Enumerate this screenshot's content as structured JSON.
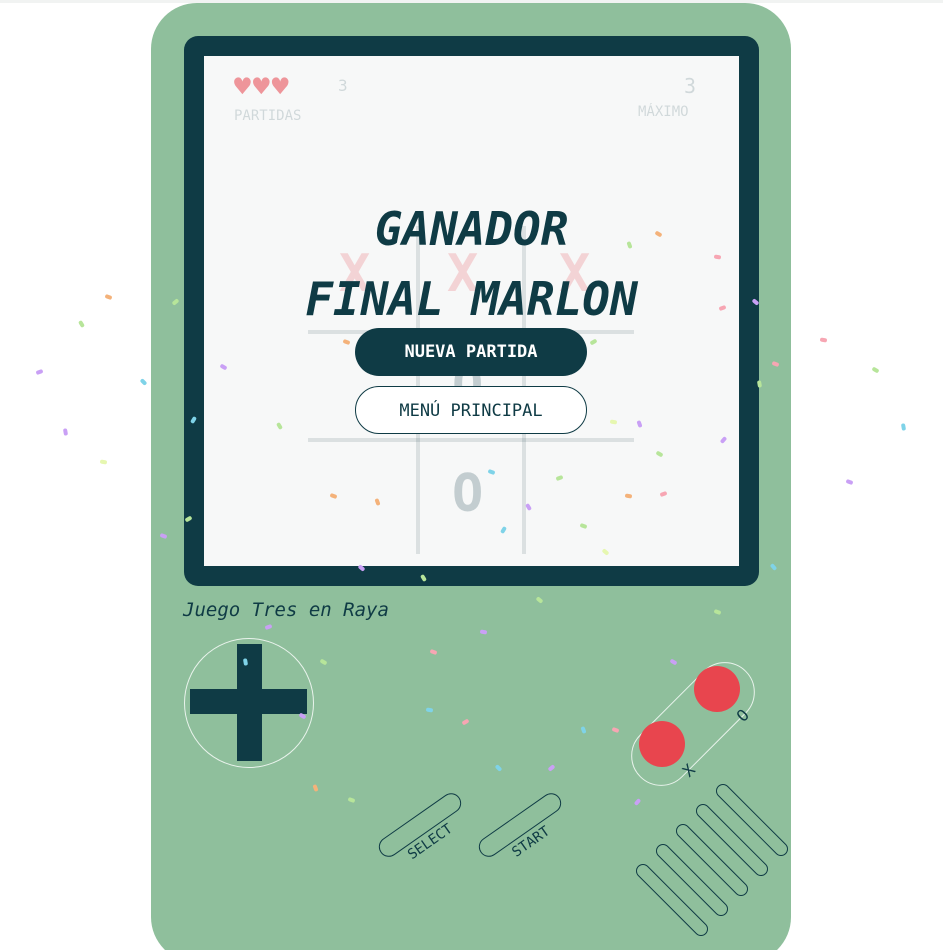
{
  "colors": {
    "console_body": "#8fbf9c",
    "screen_frame": "#0f3b45",
    "screen_bg": "#f7f8f8",
    "accent_red": "#e8454e",
    "dark": "#0f3b45"
  },
  "hud": {
    "hearts": "♥♥♥",
    "lives_count": "3",
    "lives_label": "PARTIDAS",
    "score": "3",
    "score_label": "MÁXIMO"
  },
  "board": {
    "cells": [
      "X",
      "X",
      "X",
      "",
      "O",
      "",
      "",
      "O",
      ""
    ]
  },
  "overlay": {
    "title_line1": "GANADOR",
    "title_line2": "FINAL MARLON",
    "new_game_label": "NUEVA PARTIDA",
    "main_menu_label": "MENÚ PRINCIPAL"
  },
  "console": {
    "label": "Juego Tres en Raya",
    "button_o_label": "O",
    "button_x_label": "X",
    "select_label": "SELECT",
    "start_label": "START"
  },
  "icons": {
    "dpad": "dpad-cross-icon",
    "hearts": "heart-icon"
  }
}
